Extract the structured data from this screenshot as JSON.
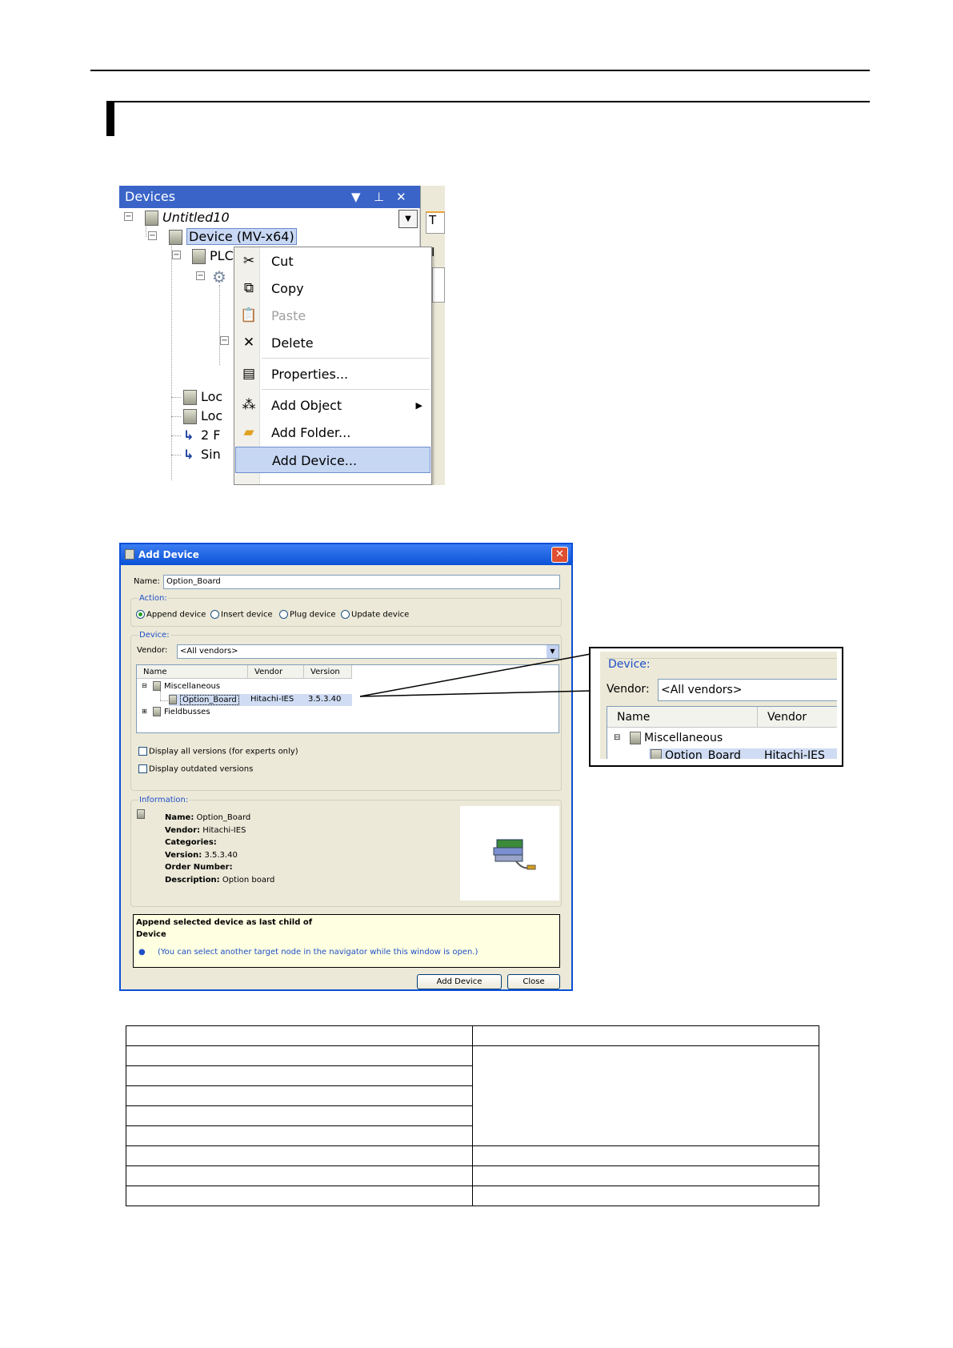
{
  "devices_panel": {
    "title": "Devices",
    "pin_icon": "pin-icon",
    "close_icon": "close-icon",
    "tree": {
      "project": "Untitled10",
      "device": "Device (MV-x64)",
      "plc_partial": "PLC",
      "loc1_partial": "Loc",
      "loc2_partial": "Loc",
      "two_partial": "2 F",
      "sin_partial": "Sin"
    },
    "tab_partial": "T",
    "right_partial": "I"
  },
  "context_menu": {
    "items": [
      {
        "label": "Cut",
        "icon": "scissors-icon",
        "enabled": true
      },
      {
        "label": "Copy",
        "icon": "copy-icon",
        "enabled": true
      },
      {
        "label": "Paste",
        "icon": "paste-icon",
        "enabled": false
      },
      {
        "label": "Delete",
        "icon": "delete-icon",
        "enabled": true
      },
      {
        "label": "Properties...",
        "icon": "properties-icon",
        "enabled": true
      },
      {
        "label": "Add Object",
        "icon": "add-object-icon",
        "enabled": true,
        "submenu": true
      },
      {
        "label": "Add Folder...",
        "icon": "folder-icon",
        "enabled": true
      },
      {
        "label": "Add Device...",
        "icon": "",
        "enabled": true,
        "highlighted": true
      }
    ]
  },
  "add_device_dialog": {
    "title": "Add Device",
    "name_label": "Name:",
    "name_value": "Option_Board",
    "action_label": "Action:",
    "actions": [
      {
        "label": "Append device",
        "selected": true
      },
      {
        "label": "Insert device",
        "selected": false
      },
      {
        "label": "Plug device",
        "selected": false
      },
      {
        "label": "Update device",
        "selected": false
      }
    ],
    "device_label": "Device:",
    "vendor_label": "Vendor:",
    "vendor_value": "<All vendors>",
    "columns": [
      "Name",
      "Vendor",
      "Version"
    ],
    "tree": {
      "group1": "Miscellaneous",
      "item_name": "Option_Board",
      "item_vendor": "Hitachi-IES",
      "item_version": "3.5.3.40",
      "group2": "Fieldbusses"
    },
    "checkboxes": [
      {
        "label": "Display all versions (for experts only)",
        "checked": false
      },
      {
        "label": "Display outdated versions",
        "checked": false
      }
    ],
    "information_label": "Information:",
    "info": {
      "name_key": "Name:",
      "name_val": " Option_Board",
      "vendor_key": "Vendor:",
      "vendor_val": " Hitachi-IES",
      "categories_key": "Categories:",
      "version_key": "Version:",
      "version_val": " 3.5.3.40",
      "order_key": "Order Number:",
      "description_key": "Description:",
      "description_val": " Option board"
    },
    "hint_line1": "Append selected device as last child of",
    "hint_line2": "Device",
    "hint_note": "(You can select another target node in the navigator while this window is open.)",
    "add_button": "Add Device",
    "close_button": "Close"
  },
  "zoom_callout": {
    "device_label": "Device:",
    "vendor_label": "Vendor:",
    "vendor_value": "<All vendors>",
    "col_name": "Name",
    "col_vendor": "Vendor",
    "group": "Miscellaneous",
    "item_name": "Option_Board",
    "item_vendor": "Hitachi-IES"
  }
}
